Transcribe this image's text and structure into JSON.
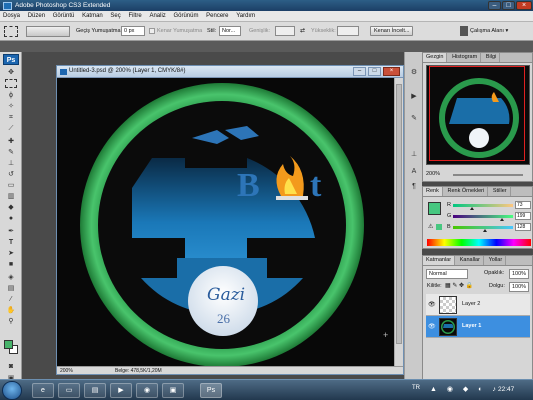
{
  "app": {
    "title": "Adobe Photoshop CS3 Extended"
  },
  "menu": [
    "Dosya",
    "Düzen",
    "Görüntü",
    "Katman",
    "Seç",
    "Filtre",
    "Analiz",
    "Görünüm",
    "Pencere",
    "Yardım"
  ],
  "options": {
    "feather_label": "Geçiş Yumuşatma:",
    "feather_value": "0 px",
    "antialias_label": "Kenar Yumuşatma",
    "style_label": "Stil:",
    "style_value": "Nor...",
    "width_label": "Genişlik:",
    "height_label": "Yükseklik:",
    "refine_label": "Kenarı İncelt...",
    "workspace_label": "Çalışma Alanı ▾"
  },
  "toolbar": {
    "logo": "Ps"
  },
  "document": {
    "title": "Untitled-3.psd @ 200% (Layer 1, CMYK/8#)",
    "zoom": "200%",
    "doc_size": "Belge: 478,5K/1,20M",
    "logo_text_b": "B",
    "logo_text_t": "t",
    "logo_signature": "Gazi",
    "logo_number": "26"
  },
  "navigator": {
    "tabs": [
      "Gezgin",
      "Histogram",
      "Bilgi"
    ],
    "zoom": "200%"
  },
  "color": {
    "tabs": [
      "Renk",
      "Renk Örnekleri",
      "Stiller"
    ],
    "channels": [
      {
        "label": "R",
        "value": "73",
        "frac": 0.29
      },
      {
        "label": "G",
        "value": "199",
        "frac": 0.78
      },
      {
        "label": "B",
        "value": "128",
        "frac": 0.5
      }
    ],
    "swatch": "#47c780"
  },
  "layers": {
    "tabs": [
      "Katmanlar",
      "Kanallar",
      "Yollar"
    ],
    "blend_mode": "Normal",
    "opacity_label": "Opaklık:",
    "opacity_value": "100%",
    "lock_label": "Kilitle:",
    "fill_label": "Dolgu:",
    "fill_value": "100%",
    "items": [
      {
        "name": "Layer 2"
      },
      {
        "name": "Layer 1"
      }
    ]
  },
  "taskbar": {
    "lang": "TR",
    "clock": "22:47"
  },
  "colors": {
    "accent": "#2d8ad6",
    "ring_green": "#2fae55",
    "disc_blue": "#1a6ea8"
  }
}
